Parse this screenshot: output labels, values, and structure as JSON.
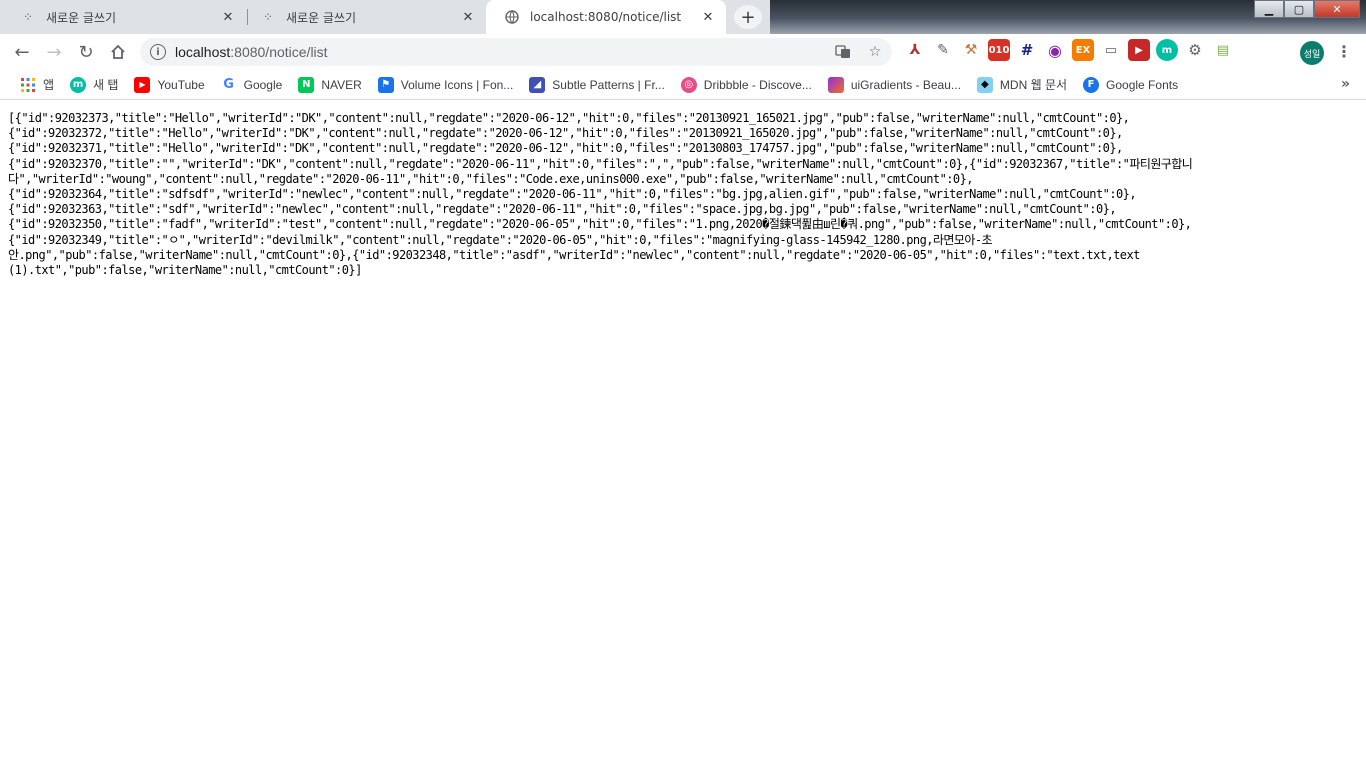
{
  "tabs": [
    {
      "label": "새로운 글쓰기",
      "close": "✕",
      "icon": "dots-icon"
    },
    {
      "label": "새로운 글쓰기",
      "close": "✕",
      "icon": "dots-icon"
    },
    {
      "label": "localhost:8080/notice/list",
      "close": "✕",
      "icon": "globe-icon"
    }
  ],
  "new_tab": "+",
  "window_buttons": {
    "minimize": "▁",
    "maximize": "▢",
    "close": "✕"
  },
  "omnibox": {
    "host": "localhost",
    "path": ":8080/notice/list"
  },
  "profile": {
    "initials": "성일"
  },
  "bookmarks": [
    {
      "label": "앱",
      "icon": "apps-grid-icon",
      "color": "#ea4335"
    },
    {
      "label": "새 탭",
      "icon": "m-icon",
      "color": "#00bfa5"
    },
    {
      "label": "YouTube",
      "icon": "youtube-icon",
      "color": "#ff0000"
    },
    {
      "label": "Google",
      "icon": "google-icon",
      "color": "#4285f4"
    },
    {
      "label": "NAVER",
      "icon": "naver-icon",
      "color": "#03c75a"
    },
    {
      "label": "Volume Icons | Fon...",
      "icon": "flag-icon",
      "color": "#1a73e8"
    },
    {
      "label": "Subtle Patterns | Fr...",
      "icon": "subtle-patterns-icon",
      "color": "#3f51b5"
    },
    {
      "label": "Dribbble - Discove...",
      "icon": "dribbble-icon",
      "color": "#ea4c89"
    },
    {
      "label": "uiGradients - Beau...",
      "icon": "gradient-icon",
      "color": "#8e2de2"
    },
    {
      "label": "MDN 웹 문서",
      "icon": "mdn-icon",
      "color": "#83d0f2"
    },
    {
      "label": "Google Fonts",
      "icon": "google-fonts-icon",
      "color": "#1a73e8"
    }
  ],
  "bookmarks_more": "»",
  "page_text": "[{\"id\":92032373,\"title\":\"Hello\",\"writerId\":\"DK\",\"content\":null,\"regdate\":\"2020-06-12\",\"hit\":0,\"files\":\"20130921_165021.jpg\",\"pub\":false,\"writerName\":null,\"cmtCount\":0},\n{\"id\":92032372,\"title\":\"Hello\",\"writerId\":\"DK\",\"content\":null,\"regdate\":\"2020-06-12\",\"hit\":0,\"files\":\"20130921_165020.jpg\",\"pub\":false,\"writerName\":null,\"cmtCount\":0},\n{\"id\":92032371,\"title\":\"Hello\",\"writerId\":\"DK\",\"content\":null,\"regdate\":\"2020-06-12\",\"hit\":0,\"files\":\"20130803_174757.jpg\",\"pub\":false,\"writerName\":null,\"cmtCount\":0},\n{\"id\":92032370,\"title\":\"\",\"writerId\":\"DK\",\"content\":null,\"regdate\":\"2020-06-11\",\"hit\":0,\"files\":\",\",\"pub\":false,\"writerName\":null,\"cmtCount\":0},{\"id\":92032367,\"title\":\"파티원구합니\n다\",\"writerId\":\"woung\",\"content\":null,\"regdate\":\"2020-06-11\",\"hit\":0,\"files\":\"Code.exe,unins000.exe\",\"pub\":false,\"writerName\":null,\"cmtCount\":0},\n{\"id\":92032364,\"title\":\"sdfsdf\",\"writerId\":\"newlec\",\"content\":null,\"regdate\":\"2020-06-11\",\"hit\":0,\"files\":\"bg.jpg,alien.gif\",\"pub\":false,\"writerName\":null,\"cmtCount\":0},\n{\"id\":92032363,\"title\":\"sdf\",\"writerId\":\"newlec\",\"content\":null,\"regdate\":\"2020-06-11\",\"hit\":0,\"files\":\"space.jpg,bg.jpg\",\"pub\":false,\"writerName\":null,\"cmtCount\":0},\n{\"id\":92032350,\"title\":\"fadf\",\"writerId\":\"test\",\"content\":null,\"regdate\":\"2020-06-05\",\"hit\":0,\"files\":\"1.png,2020�절鍊댁퓚由ш린�쿼.png\",\"pub\":false,\"writerName\":null,\"cmtCount\":0},\n{\"id\":92032349,\"title\":\"ㅇ\",\"writerId\":\"devilmilk\",\"content\":null,\"regdate\":\"2020-06-05\",\"hit\":0,\"files\":\"magnifying-glass-145942_1280.png,라면모아-초\n안.png\",\"pub\":false,\"writerName\":null,\"cmtCount\":0},{\"id\":92032348,\"title\":\"asdf\",\"writerId\":\"newlec\",\"content\":null,\"regdate\":\"2020-06-05\",\"hit\":0,\"files\":\"text.txt,text\n(1).txt\",\"pub\":false,\"writerName\":null,\"cmtCount\":0}]"
}
